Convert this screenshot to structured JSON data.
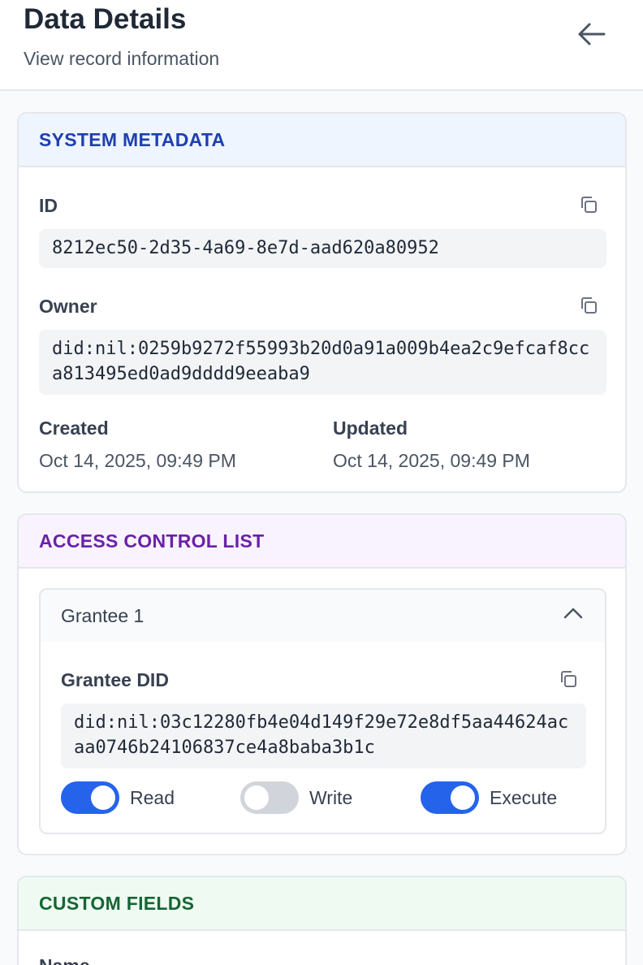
{
  "header": {
    "title": "Data Details",
    "subtitle": "View record information"
  },
  "system_metadata": {
    "heading": "SYSTEM METADATA",
    "id_label": "ID",
    "id_value": "8212ec50-2d35-4a69-8e7d-aad620a80952",
    "owner_label": "Owner",
    "owner_value": "did:nil:0259b9272f55993b20d0a91a009b4ea2c9efcaf8cca813495ed0ad9dddd9eeaba9",
    "created_label": "Created",
    "created_value": "Oct 14, 2025, 09:49 PM",
    "updated_label": "Updated",
    "updated_value": "Oct 14, 2025, 09:49 PM"
  },
  "acl": {
    "heading": "ACCESS CONTROL LIST",
    "grantees": [
      {
        "title": "Grantee 1",
        "did_label": "Grantee DID",
        "did_value": "did:nil:03c12280fb4e04d149f29e72e8df5aa44624acaa0746b24106837ce4a8baba3b1c",
        "permissions": [
          {
            "label": "Read",
            "enabled": true
          },
          {
            "label": "Write",
            "enabled": false
          },
          {
            "label": "Execute",
            "enabled": true
          }
        ]
      }
    ]
  },
  "custom_fields": {
    "heading": "CUSTOM FIELDS",
    "first_field_label": "Name"
  },
  "colors": {
    "accent": "#2563eb",
    "system_heading": "#1e40af",
    "acl_heading": "#6b21a8",
    "custom_heading": "#166534"
  },
  "icons": {
    "back": "arrow-left-icon",
    "copy": "copy-icon",
    "collapse": "chevron-up-icon"
  }
}
